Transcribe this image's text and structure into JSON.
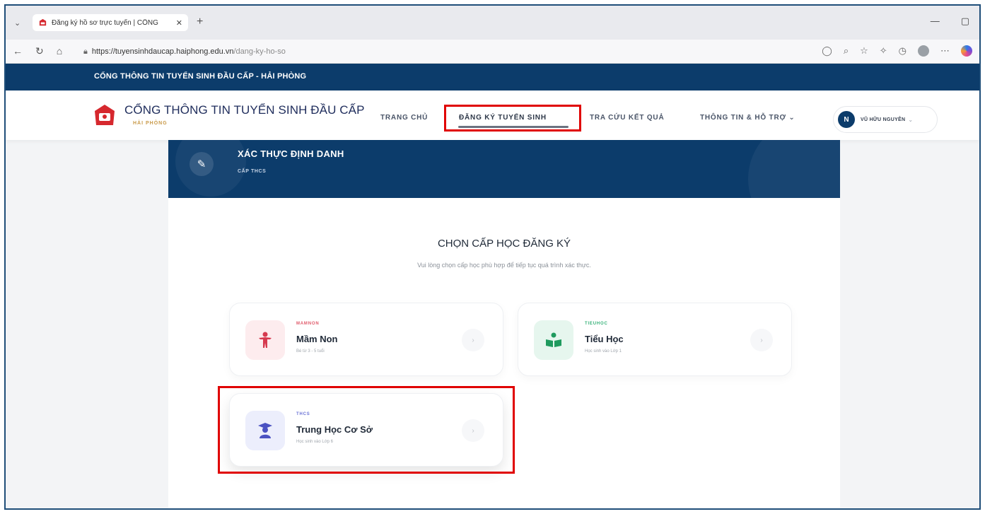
{
  "browser": {
    "tab_title": "Đăng ký hồ sơ trực tuyến | CỔNG",
    "tab_close": "✕",
    "new_tab": "+",
    "url_host": "https://tuyensinhdaucap.haiphong.edu.vn",
    "url_path": "/dang-ky-ho-so",
    "window_minimize": "—",
    "window_restore": "▢"
  },
  "topbar": {
    "text": "CỔNG THÔNG TIN TUYỂN SINH ĐẦU CẤP - HẢI PHÒNG"
  },
  "header": {
    "brand_title": "CỔNG THÔNG TIN TUYỂN SINH ĐẦU CẤP",
    "brand_subtitle": "HẢI PHÒNG",
    "menu": {
      "home": "TRANG CHỦ",
      "register": "ĐĂNG KÝ TUYỂN SINH",
      "lookup": "TRA CỨU KẾT QUẢ",
      "info": "THÔNG TIN & HỖ TRỢ ⌄"
    },
    "user": {
      "initial": "N",
      "name": "VŨ HỮU NGUYÊN",
      "caret": "⌄"
    }
  },
  "hero": {
    "title": "XÁC THỰC ĐỊNH DANH",
    "subtitle": "CẤP THCS"
  },
  "main": {
    "title": "CHỌN CẤP HỌC ĐĂNG KÝ",
    "subtitle": "Vui lòng chọn cấp học phù hợp để tiếp tục quá trình xác thực.",
    "levels": [
      {
        "tag": "MAMNON",
        "name": "Mầm Non",
        "desc": "Bé từ 3 - 5 tuổi",
        "tag_color": "#e05a6a",
        "icon_bg": "#fdecee",
        "icon_color": "#d63a4f",
        "icon": "child-icon"
      },
      {
        "tag": "TIEUHOC",
        "name": "Tiểu Học",
        "desc": "Học sinh vào Lớp 1",
        "tag_color": "#38b27a",
        "icon_bg": "#e6f6ee",
        "icon_color": "#1f9a5e",
        "icon": "book-icon"
      },
      {
        "tag": "THCS",
        "name": "Trung Học Cơ Sở",
        "desc": "Học sinh vào Lớp 6",
        "tag_color": "#6b73d6",
        "icon_bg": "#eceefc",
        "icon_color": "#4b52c2",
        "icon": "graduate-icon"
      }
    ]
  },
  "colors": {
    "primary": "#0c3c6b",
    "highlight": "#e00000"
  }
}
